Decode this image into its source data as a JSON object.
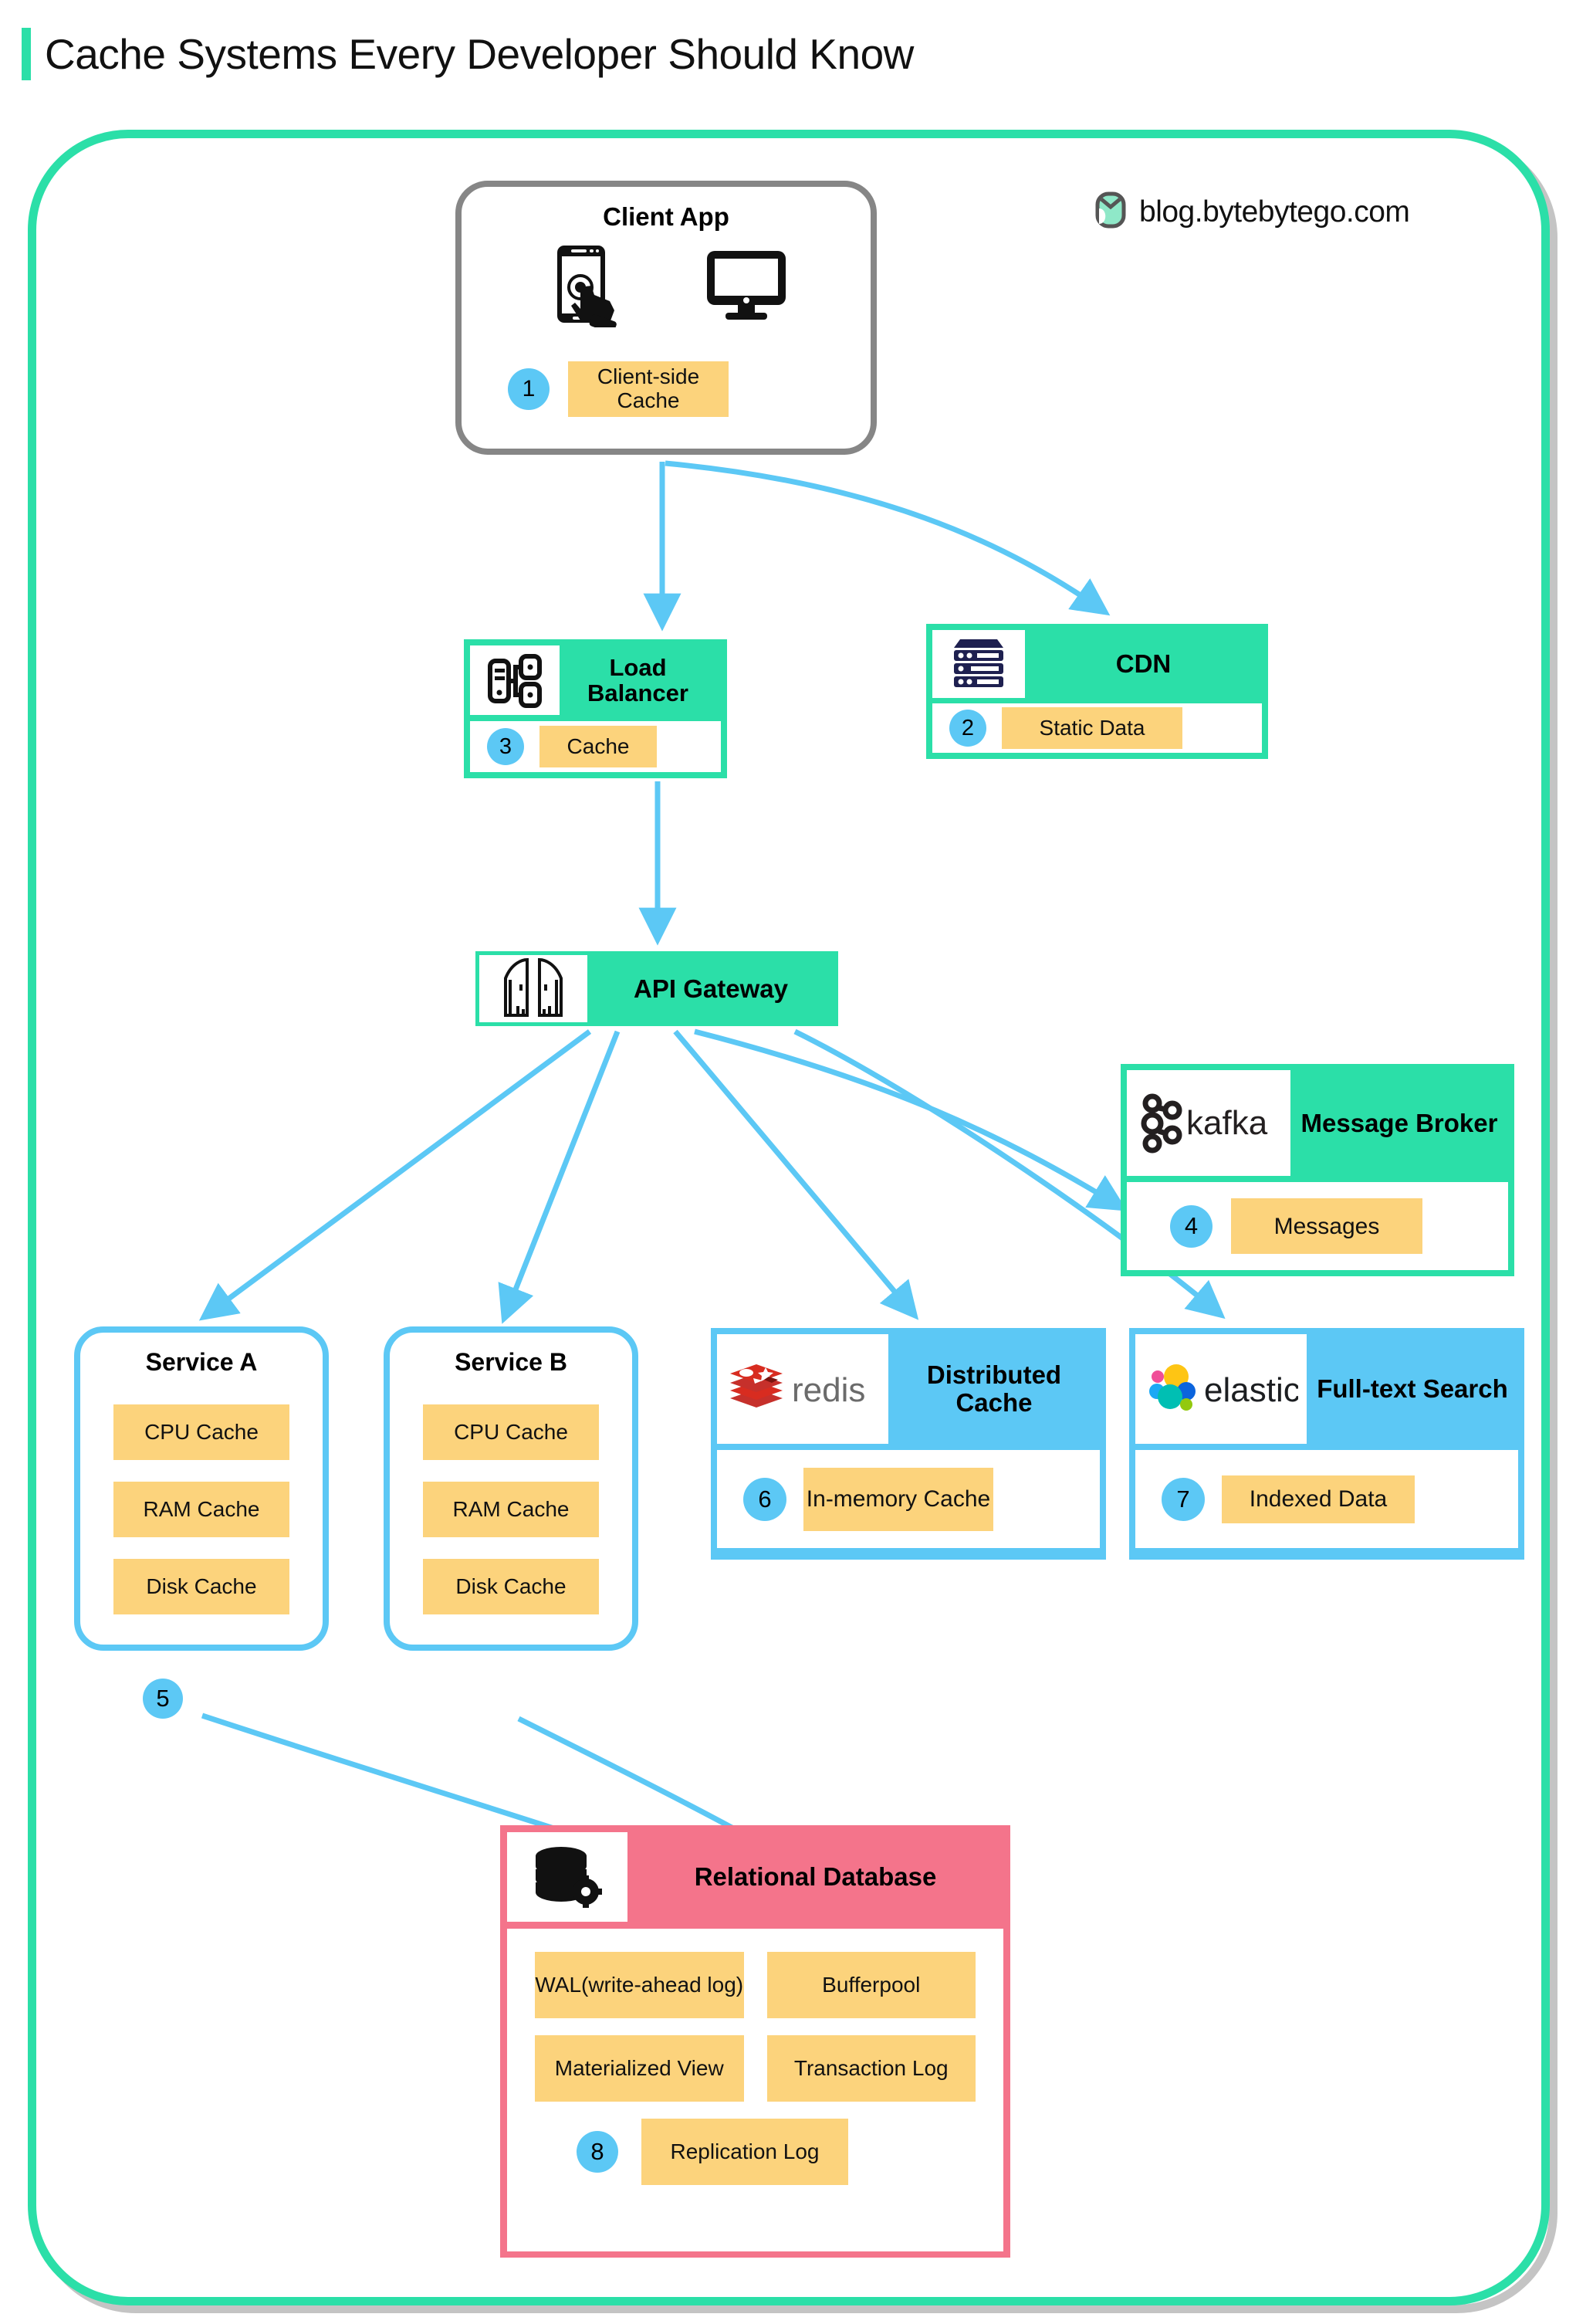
{
  "page": {
    "title": "Cache Systems Every Developer Should Know",
    "accent_color": "#2bdfa8",
    "watermark": "blog.bytebytego.com",
    "watermark_icon": "bytebytego-logo-icon"
  },
  "colors": {
    "teal": "#2bdfa8",
    "blue": "#5cc8f5",
    "amber": "#fcd37c",
    "pink": "#f4748b",
    "gray": "#868686"
  },
  "nodes": {
    "client_app": {
      "title": "Client App",
      "icons": [
        "mobile-tap-icon",
        "desktop-monitor-icon"
      ],
      "badge": "1",
      "cache_label": "Client-side Cache"
    },
    "load_balancer": {
      "title": "Load Balancer",
      "icon": "load-balancer-icon",
      "badge": "3",
      "cache_label": "Cache"
    },
    "cdn": {
      "title": "CDN",
      "icon": "server-rack-icon",
      "badge": "2",
      "cache_label": "Static Data"
    },
    "api_gateway": {
      "title": "API Gateway",
      "icon": "gateway-doors-icon"
    },
    "message_broker": {
      "title": "Message Broker",
      "icon": "kafka-logo-icon",
      "logo_text": "kafka",
      "badge": "4",
      "cache_label": "Messages"
    },
    "service_a": {
      "title": "Service A",
      "badge": "5",
      "caches": [
        "CPU Cache",
        "RAM Cache",
        "Disk Cache"
      ]
    },
    "service_b": {
      "title": "Service B",
      "caches": [
        "CPU Cache",
        "RAM Cache",
        "Disk Cache"
      ]
    },
    "distributed_cache": {
      "title": "Distributed Cache",
      "icon": "redis-logo-icon",
      "logo_text": "redis",
      "badge": "6",
      "cache_label": "In-memory Cache"
    },
    "full_text_search": {
      "title": "Full-text Search",
      "icon": "elastic-logo-icon",
      "logo_text": "elastic",
      "badge": "7",
      "cache_label": "Indexed Data"
    },
    "relational_database": {
      "title": "Relational Database",
      "icon": "database-gear-icon",
      "badge": "8",
      "caches": [
        "WAL(write-ahead log)",
        "Bufferpool",
        "Materialized View",
        "Transaction Log"
      ],
      "last_cache": "Replication Log"
    }
  }
}
